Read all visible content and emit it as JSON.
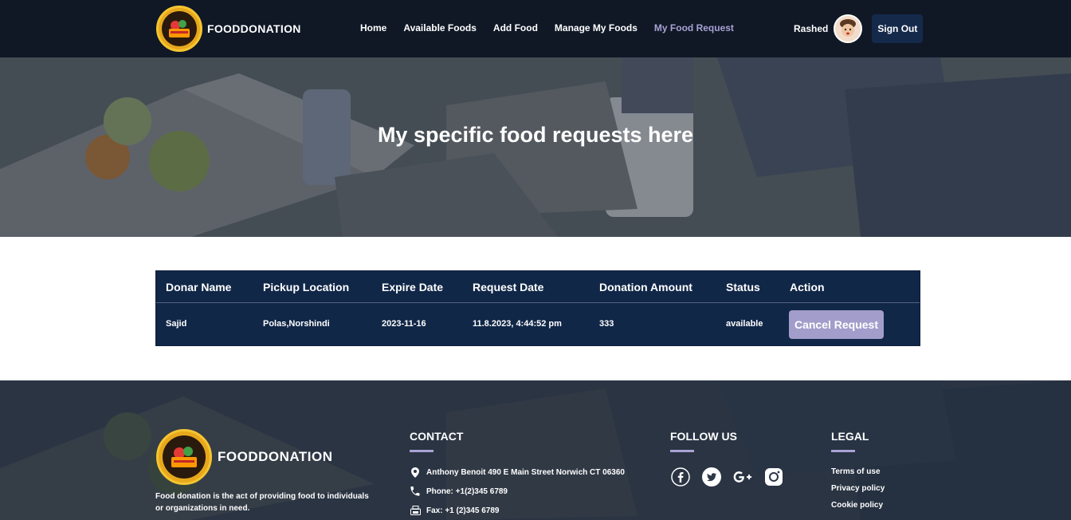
{
  "navbar": {
    "brand": "FOODDONATION",
    "links": [
      {
        "label": "Home"
      },
      {
        "label": "Available Foods"
      },
      {
        "label": "Add Food"
      },
      {
        "label": "Manage My Foods"
      },
      {
        "label": "My Food Request",
        "active": true
      }
    ],
    "user_name": "Rashed",
    "signout_label": "Sign Out"
  },
  "hero": {
    "title": "My specific food requests here"
  },
  "table": {
    "headers": [
      "Donar Name",
      "Pickup Location",
      "Expire Date",
      "Request Date",
      "Donation Amount",
      "Status",
      "Action"
    ],
    "rows": [
      {
        "donar_name": "Sajid",
        "pickup_location": "Polas,Norshindi",
        "expire_date": "2023-11-16",
        "request_date": "11.8.2023, 4:44:52 pm",
        "donation_amount": "333",
        "status": "available",
        "action_label": "Cancel Request"
      }
    ]
  },
  "footer": {
    "brand": "FOODDONATION",
    "description": "Food donation is the act of providing food to individuals or organizations in need.",
    "contact": {
      "heading": "CONTACT",
      "address": "Anthony Benoit 490 E Main Street Norwich CT 06360",
      "phone": "Phone: +1(2)345 6789",
      "fax": "Fax: +1 (2)345 6789"
    },
    "follow": {
      "heading": "FOLLOW US",
      "icons": [
        "facebook-icon",
        "twitter-icon",
        "google-plus-icon",
        "instagram-icon"
      ]
    },
    "legal": {
      "heading": "LEGAL",
      "links": [
        "Terms of use",
        "Privacy policy",
        "Cookie policy"
      ]
    }
  },
  "colors": {
    "navbar_bg": "#101826",
    "accent": "#a8a2d4",
    "table_bg": "#112748",
    "button_bg": "#a29dcb",
    "signout_bg": "#15294a"
  }
}
